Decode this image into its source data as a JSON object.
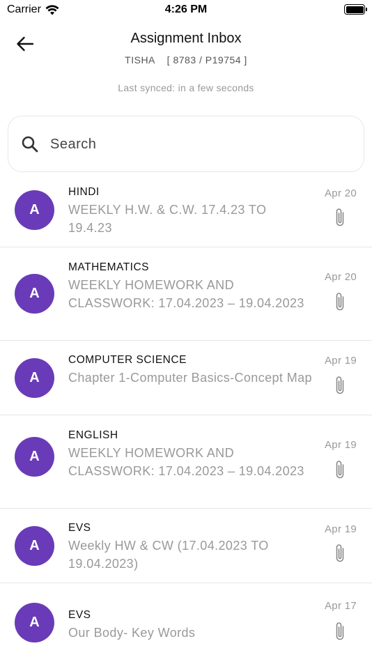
{
  "status_bar": {
    "carrier": "Carrier",
    "time": "4:26 PM"
  },
  "header": {
    "title": "Assignment Inbox",
    "subtitle": "TISHA    [ 8783 / P19754 ]",
    "synced": "Last synced: in a few seconds"
  },
  "search": {
    "placeholder": "Search",
    "value": ""
  },
  "items": [
    {
      "avatar": "A",
      "subject": "HINDI",
      "desc": "WEEKLY H.W. & C.W. 17.4.23 TO 19.4.23",
      "date": "Apr 20",
      "icon": "paperclip-icon"
    },
    {
      "avatar": "A",
      "subject": "MATHEMATICS",
      "desc": "WEEKLY HOMEWORK AND CLASSWORK: 17.04.2023 – 19.04.2023",
      "date": "Apr 20",
      "icon": "paperclip-icon"
    },
    {
      "avatar": "A",
      "subject": "COMPUTER SCIENCE",
      "desc": "Chapter 1-Computer Basics-Concept Map",
      "date": "Apr 19",
      "icon": "paperclip-icon"
    },
    {
      "avatar": "A",
      "subject": "ENGLISH",
      "desc": "WEEKLY HOMEWORK AND CLASSWORK: 17.04.2023 – 19.04.2023",
      "date": "Apr 19",
      "icon": "paperclip-icon"
    },
    {
      "avatar": "A",
      "subject": "EVS",
      "desc": "Weekly HW & CW (17.04.2023 TO 19.04.2023)",
      "date": "Apr 19",
      "icon": "paperclip-icon"
    },
    {
      "avatar": "A",
      "subject": "EVS",
      "desc": "Our Body- Key Words",
      "date": "Apr 17",
      "icon": "paperclip-icon"
    }
  ],
  "colors": {
    "avatar_bg": "#6a3bb8",
    "muted_text": "#999999",
    "divider": "#e6e6e6"
  }
}
